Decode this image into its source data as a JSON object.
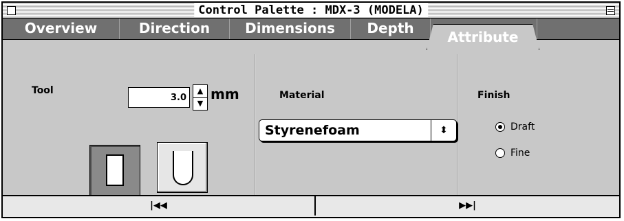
{
  "window": {
    "title": "Control Palette : MDX-3 (MODELA)"
  },
  "tabs": [
    {
      "label": "Overview"
    },
    {
      "label": "Direction"
    },
    {
      "label": "Dimensions"
    },
    {
      "label": "Depth"
    },
    {
      "label": "Attribute",
      "active": true
    }
  ],
  "tool": {
    "label": "Tool",
    "value": "3.0",
    "unit": "mm",
    "up_glyph": "▲",
    "down_glyph": "▼"
  },
  "material": {
    "label": "Material",
    "selected": "Styrenefoam",
    "arrow_glyph": "⬍"
  },
  "finish": {
    "label": "Finish",
    "options": [
      "Draft",
      "Fine"
    ],
    "selected": "Draft"
  },
  "nav": {
    "prev_glyph": "|◀◀",
    "next_glyph": "▶▶|"
  },
  "icons": [
    "close-box-icon",
    "zoom-box-icon",
    "flat-end-mill-icon",
    "ball-end-mill-icon"
  ]
}
